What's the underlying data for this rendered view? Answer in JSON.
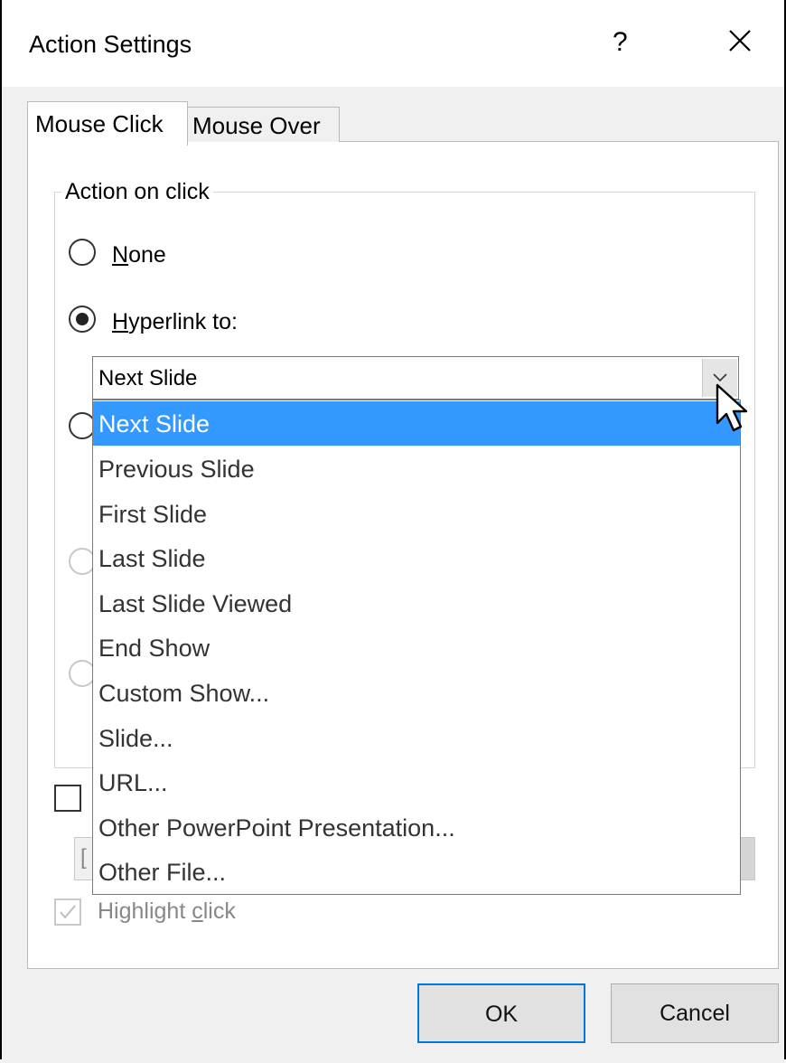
{
  "window": {
    "title": "Action Settings",
    "help_label": "?"
  },
  "tabs": [
    {
      "label": "Mouse Click",
      "active": true
    },
    {
      "label": "Mouse Over",
      "active": false
    }
  ],
  "action_group": {
    "label": "Action on click",
    "options": {
      "none": {
        "accel": "N",
        "rest": "one",
        "selected": false
      },
      "hyperlink": {
        "accel": "H",
        "rest": "yperlink to:",
        "selected": true
      }
    }
  },
  "hyperlink_combo": {
    "value": "Next Slide",
    "expanded": true
  },
  "dropdown": {
    "items": [
      "Next Slide",
      "Previous Slide",
      "First Slide",
      "Last Slide",
      "Last Slide Viewed",
      "End Show",
      "Custom Show...",
      "Slide...",
      "URL...",
      "Other PowerPoint Presentation...",
      "Other File..."
    ],
    "selected_index": 0
  },
  "play_sound": {
    "value_partial": "["
  },
  "highlight_click": {
    "pre": "Highlight ",
    "accel": "c",
    "rest": "lick",
    "checked": true,
    "disabled": true
  },
  "buttons": {
    "ok": "OK",
    "cancel": "Cancel"
  },
  "colors": {
    "selection": "#3399ff",
    "ok_border": "#0078d7",
    "panel": "#ffffff",
    "dialog_bg": "#f0f0f0"
  }
}
